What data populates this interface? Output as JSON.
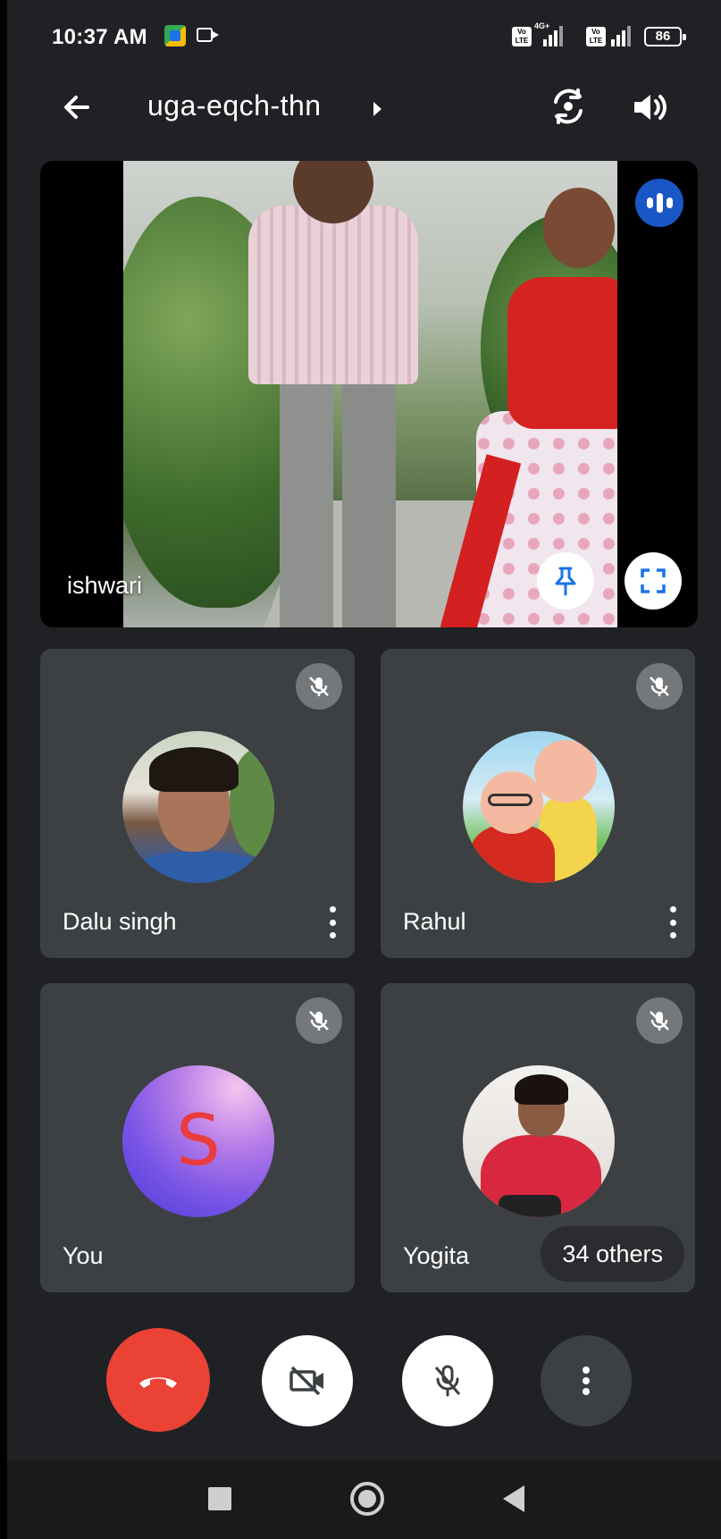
{
  "status_bar": {
    "time": "10:37 AM",
    "network_label": "4G+",
    "volte_label": "Vo LTE",
    "battery": "86"
  },
  "header": {
    "meeting_code": "uga-eqch-thn",
    "icons": [
      "back-arrow-icon",
      "switch-camera-icon",
      "speaker-icon"
    ]
  },
  "main_tile": {
    "participant": "ishwari",
    "speaking": true,
    "actions": [
      "pin-icon",
      "fullscreen-icon"
    ]
  },
  "participants": [
    {
      "name": "Dalu singh",
      "muted": true,
      "avatar": "photo"
    },
    {
      "name": "Rahul",
      "muted": true,
      "avatar": "cartoon"
    },
    {
      "name": "You",
      "muted": true,
      "avatar_letter": "S"
    },
    {
      "name": "Yogita",
      "muted": true,
      "avatar": "photo"
    }
  ],
  "others_label": "34 others",
  "controls": [
    "end-call-icon",
    "camera-off-icon",
    "mic-off-icon",
    "more-vert-icon"
  ],
  "nav": [
    "recents-icon",
    "home-icon",
    "back-icon"
  ],
  "colors": {
    "background": "#202124",
    "tile": "#3c4043",
    "end_call": "#ea4335",
    "speaking": "#1a57c6"
  }
}
